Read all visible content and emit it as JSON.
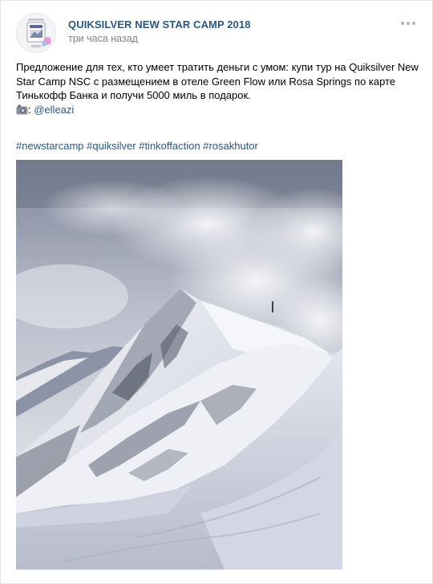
{
  "post": {
    "group_name": "QUIKSILVER NEW STAR CAMP 2018",
    "time": "три часа назад",
    "text_lines": [
      "Предложение для тех, кто умеет тратить деньги с умом: купи тур на Quiksilver New",
      "Star Camp NSC с размещением в отеле Green Flow или Rosa Springs по карте",
      "Тинькофф Банка и получи 5000 миль в подарок."
    ],
    "photo_credit_prefix": ": ",
    "photo_credit_link": "@elleazi",
    "camera_icon": "camera-emoji-icon",
    "hashtags": [
      "#newstarcamp",
      "#quiksilver",
      "#tinkoffaction",
      "#rosakhutor"
    ],
    "more_icon": "more-dots-icon",
    "photo_subject": "snowy-mountain-peak-photo"
  },
  "colors": {
    "link": "#2a5885",
    "meta": "#828282",
    "text": "#000000",
    "border": "#e3e4e8"
  }
}
